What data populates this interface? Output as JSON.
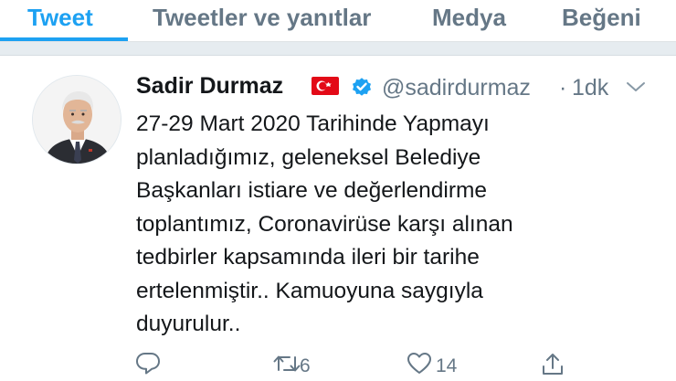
{
  "tabs": [
    {
      "label": "Tweet",
      "active": true
    },
    {
      "label": "Tweetler ve yanıtlar",
      "active": false
    },
    {
      "label": "Medya",
      "active": false
    },
    {
      "label": "Beğeni",
      "active": false
    }
  ],
  "tweet": {
    "display_name": "Sadir Durmaz",
    "handle": "@sadirdurmaz",
    "separator": "·",
    "time": "1dk",
    "lines": [
      "27-29 Mart 2020 Tarihinde Yapmayı",
      "planladığımız, geleneksel Belediye",
      "Başkanları istiare ve değerlendirme",
      "toplantımız, Coronavirüse karşı alınan",
      "tedbirler kapsamında ileri bir tarihe",
      "ertelenmiştir.. Kamuoyuna saygıyla",
      "duyurulur.."
    ],
    "actions": {
      "retweets": "6",
      "likes": "14"
    }
  },
  "colors": {
    "accent": "#1da1f2",
    "secondary_text": "#657786",
    "primary_text": "#14171a",
    "flag_red": "#e30a17"
  },
  "icons": [
    "flag-turkey-icon",
    "verified-badge-icon",
    "chevron-down-icon",
    "reply-icon",
    "retweet-icon",
    "heart-icon",
    "share-icon"
  ]
}
